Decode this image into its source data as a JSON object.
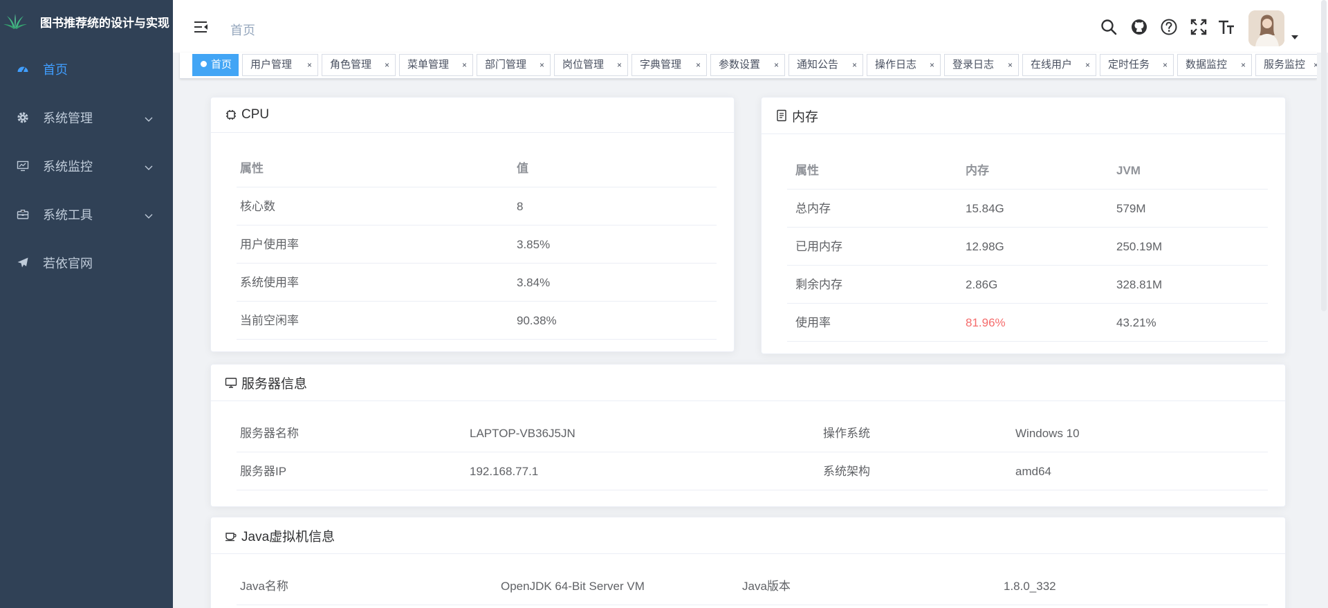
{
  "app": {
    "title": "图书推荐统的设计与实现"
  },
  "sidebar": {
    "items": [
      {
        "label": "首页",
        "icon": "dashboard-icon",
        "active": true,
        "expandable": false
      },
      {
        "label": "系统管理",
        "icon": "gear-icon",
        "active": false,
        "expandable": true
      },
      {
        "label": "系统监控",
        "icon": "monitor-icon",
        "active": false,
        "expandable": true
      },
      {
        "label": "系统工具",
        "icon": "toolbox-icon",
        "active": false,
        "expandable": true
      },
      {
        "label": "若依官网",
        "icon": "paper-plane-icon",
        "active": false,
        "expandable": false
      }
    ]
  },
  "header": {
    "breadcrumb": "首页",
    "tools": [
      "search-icon",
      "github-icon",
      "question-icon",
      "fullscreen-icon",
      "font-size-icon"
    ]
  },
  "tags": [
    {
      "label": "首页",
      "active": true
    },
    {
      "label": "用户管理"
    },
    {
      "label": "角色管理"
    },
    {
      "label": "菜单管理"
    },
    {
      "label": "部门管理"
    },
    {
      "label": "岗位管理"
    },
    {
      "label": "字典管理"
    },
    {
      "label": "参数设置"
    },
    {
      "label": "通知公告"
    },
    {
      "label": "操作日志"
    },
    {
      "label": "登录日志"
    },
    {
      "label": "在线用户"
    },
    {
      "label": "定时任务"
    },
    {
      "label": "数据监控"
    },
    {
      "label": "服务监控"
    }
  ],
  "cpu": {
    "title": "CPU",
    "columns": [
      "属性",
      "值"
    ],
    "rows": [
      [
        "核心数",
        "8"
      ],
      [
        "用户使用率",
        "3.85%"
      ],
      [
        "系统使用率",
        "3.84%"
      ],
      [
        "当前空闲率",
        "90.38%"
      ]
    ]
  },
  "memory": {
    "title": "内存",
    "columns": [
      "属性",
      "内存",
      "JVM"
    ],
    "rows": [
      [
        "总内存",
        "15.84G",
        "579M"
      ],
      [
        "已用内存",
        "12.98G",
        "250.19M"
      ],
      [
        "剩余内存",
        "2.86G",
        "328.81M"
      ],
      [
        "使用率",
        "81.96%",
        "43.21%"
      ]
    ],
    "danger_color": "#f56c6c"
  },
  "server": {
    "title": "服务器信息",
    "rows": [
      [
        "服务器名称",
        "LAPTOP-VB36J5JN",
        "操作系统",
        "Windows 10"
      ],
      [
        "服务器IP",
        "192.168.77.1",
        "系统架构",
        "amd64"
      ]
    ]
  },
  "jvm": {
    "title": "Java虚拟机信息",
    "rows": [
      [
        "Java名称",
        "OpenJDK 64-Bit Server VM",
        "Java版本",
        "1.8.0_332"
      ]
    ]
  },
  "colors": {
    "sidebar_bg": "#304156",
    "accent": "#409eff",
    "tag_active": "#42a5f5"
  }
}
